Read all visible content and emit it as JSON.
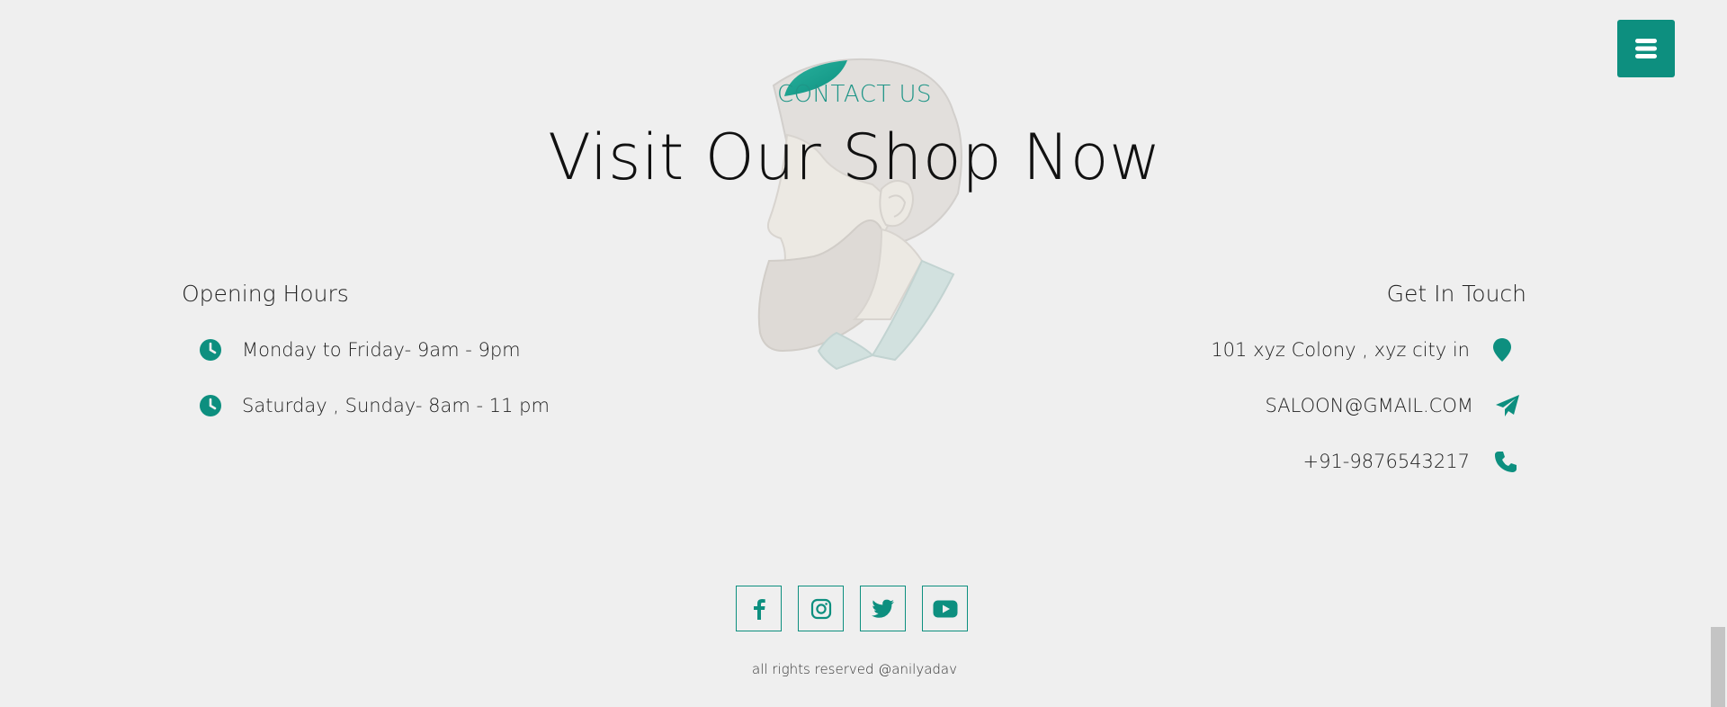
{
  "header": {
    "menu_icon": "hamburger-menu-icon"
  },
  "section": {
    "eyebrow": "CONTACT US",
    "title": "Visit Our Shop Now"
  },
  "opening_hours": {
    "heading": "Opening Hours",
    "icon": "clock-icon",
    "items": [
      {
        "text": "Monday to Friday- 9am - 9pm"
      },
      {
        "text": "Saturday , Sunday- 8am - 11 pm"
      }
    ]
  },
  "get_in_touch": {
    "heading": "Get In Touch",
    "items": [
      {
        "text": "101 xyz Colony , xyz city in",
        "icon": "map-marker-icon"
      },
      {
        "text": "SALOON@GMAIL.COM",
        "icon": "paper-plane-icon"
      },
      {
        "text": "+91-9876543217",
        "icon": "phone-icon"
      }
    ]
  },
  "social": {
    "links": [
      "facebook-icon",
      "instagram-icon",
      "twitter-icon",
      "youtube-icon"
    ]
  },
  "footer": {
    "copyright": "all rights reserved @anilyadav"
  },
  "colors": {
    "accent": "#0d8f7f",
    "background": "#efefef",
    "text": "#1a1a1a"
  }
}
